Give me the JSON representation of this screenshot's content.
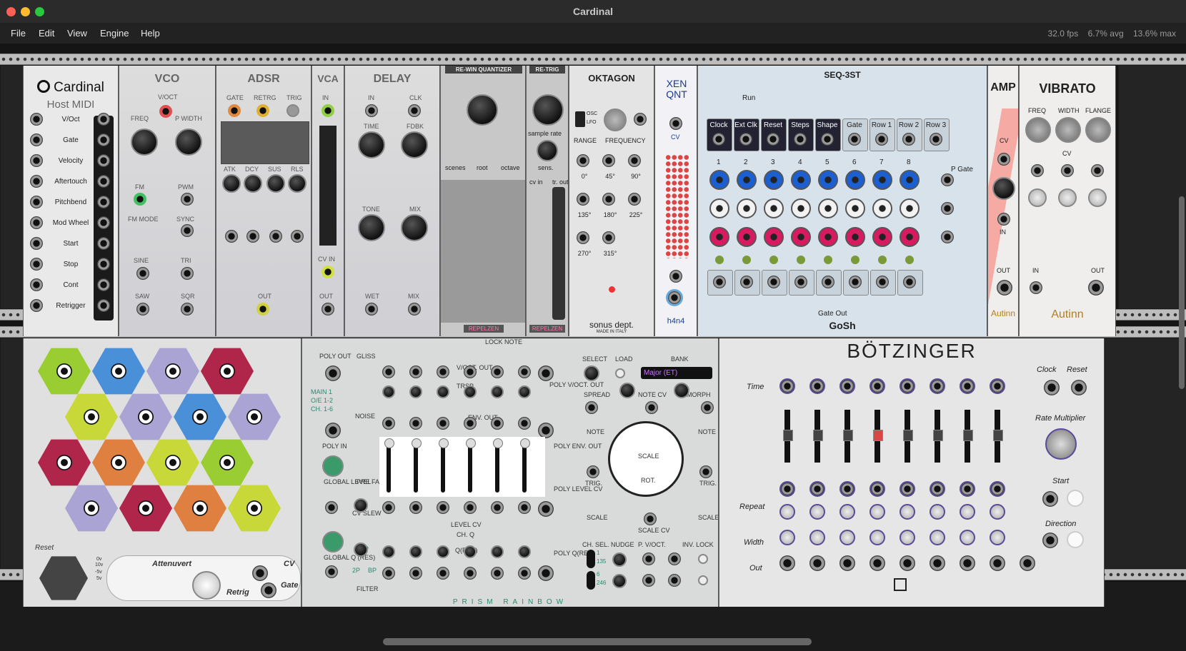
{
  "window": {
    "title": "Cardinal"
  },
  "menu": {
    "items": [
      "File",
      "Edit",
      "View",
      "Engine",
      "Help"
    ]
  },
  "stats": {
    "fps": "32.0 fps",
    "avg": "6.7% avg",
    "max": "13.6% max"
  },
  "modules": {
    "host_midi": {
      "brand": "Cardinal",
      "subtitle": "Host MIDI",
      "outputs": [
        "V/Oct",
        "Gate",
        "Velocity",
        "Aftertouch",
        "Pitchbend",
        "Mod Wheel",
        "Start",
        "Stop",
        "Cont",
        "Retrigger"
      ]
    },
    "vco": {
      "title": "VCO",
      "labels": [
        "V/OCT",
        "FREQ",
        "P WIDTH",
        "FM",
        "PWM",
        "FM MODE",
        "SYNC",
        "SINE",
        "TRI",
        "SAW",
        "SQR"
      ]
    },
    "adsr": {
      "title": "ADSR",
      "labels": [
        "GATE",
        "RETRG",
        "TRIG",
        "ATK",
        "DCY",
        "SUS",
        "RLS",
        "OUT"
      ]
    },
    "vca": {
      "title": "VCA",
      "labels": [
        "IN",
        "CV IN",
        "OUT"
      ]
    },
    "delay": {
      "title": "DELAY",
      "labels": [
        "IN",
        "CLK",
        "TIME",
        "FDBK",
        "TONE",
        "MIX",
        "WET",
        "MIX"
      ]
    },
    "quantizer": {
      "title": "RE-WIN QUANTIZER",
      "labels": [
        "scenes",
        "root",
        "octave"
      ],
      "brand": "REPELZEN"
    },
    "retrig": {
      "title": "RE-TRIG",
      "labels": [
        "sample rate",
        "sens.",
        "cv in",
        "tr. out"
      ],
      "brand": "REPELZEN"
    },
    "oktagon": {
      "title": "OKTAGON",
      "labels": [
        "OSC",
        "LFO",
        "RANGE",
        "FREQUENCY"
      ],
      "phases": [
        "0°",
        "45°",
        "90°",
        "135°",
        "180°",
        "225°",
        "270°",
        "315°"
      ],
      "brand": "sonus dept.",
      "brand_sub": "MADE IN ITALY"
    },
    "xenqnt": {
      "title": "XEN QNT",
      "labels": [
        "CV"
      ],
      "brand": "h4n4"
    },
    "seq3st": {
      "title": "SEQ-3ST",
      "top_labels": [
        "Clock",
        "Ext Clk",
        "Reset",
        "Steps",
        "Shape",
        "Gate",
        "Row 1",
        "Row 2",
        "Row 3"
      ],
      "run_label": "Run",
      "steps": [
        "1",
        "2",
        "3",
        "4",
        "5",
        "6",
        "7",
        "8"
      ],
      "pgate_label": "P Gate",
      "gateout_label": "Gate Out",
      "brand": "GoSh"
    },
    "amp": {
      "title": "AMP",
      "labels": [
        "CV",
        "IN",
        "OUT"
      ],
      "brand": "Autinn"
    },
    "vibrato": {
      "title": "VIBRATO",
      "labels": [
        "FREQ",
        "WIDTH",
        "FLANGE",
        "CV",
        "IN",
        "OUT"
      ],
      "brand": "Autinn"
    },
    "hexmod": {
      "labels": [
        "Reset",
        "Attenuvert",
        "CV",
        "Retrig",
        "Gate"
      ],
      "range_labels": [
        "0v",
        "10v",
        "-5v",
        "5v"
      ]
    },
    "prism": {
      "labels": {
        "poly_out": "POLY OUT",
        "gliss": "GLISS",
        "lock_note": "LOCK NOTE",
        "voct_out": "V/OCT. OUT",
        "trsp": "TRSP.",
        "poly_voct_out": "POLY V/OCT. OUT",
        "main": "MAIN 1",
        "oe": "O/E 1-2",
        "ch": "CH. 1-6",
        "noise": "NOISE",
        "env_out": "ENV. OUT",
        "poly_env_out": "POLY ENV. OUT",
        "poly_in": "POLY IN",
        "pre_fader": "PRE FADER",
        "global_level": "GLOBAL LEVEL",
        "poly_level_cv": "POLY LEVEL CV",
        "cv_slew": "CV SLEW",
        "level_cv": "LEVEL CV",
        "ch_q": "CH. Q",
        "q_res": "Q(RES)",
        "global_q": "GLOBAL Q (RES)",
        "filter": "FILTER",
        "poly_q": "POLY Q(RES)",
        "lp": "1P",
        "bp": "BP",
        "p2": "2P",
        "select": "SELECT",
        "load": "LOAD",
        "bank": "BANK",
        "bank_value": "Major (ET)",
        "spread": "SPREAD",
        "note_cv": "NOTE CV",
        "morph": "MORPH",
        "note": "NOTE",
        "trig": "TRIG.",
        "scale": "SCALE",
        "rot": "ROT.",
        "scale_cv": "SCALE CV",
        "ch_sel": "CH. SEL.",
        "nudge": "NUDGE",
        "p_voct": "P. V/OCT.",
        "inv_lock": "INV. LOCK",
        "sel_a": "1",
        "sel_b": "135",
        "sel_c": "6",
        "sel_d": "246"
      },
      "brand": "PRISM RAINBOW"
    },
    "botzinger": {
      "title": "BÖTZINGER",
      "labels": [
        "Time",
        "Repeat",
        "Width",
        "Out",
        "Clock",
        "Reset",
        "Rate Multiplier",
        "Start",
        "Direction"
      ]
    }
  }
}
